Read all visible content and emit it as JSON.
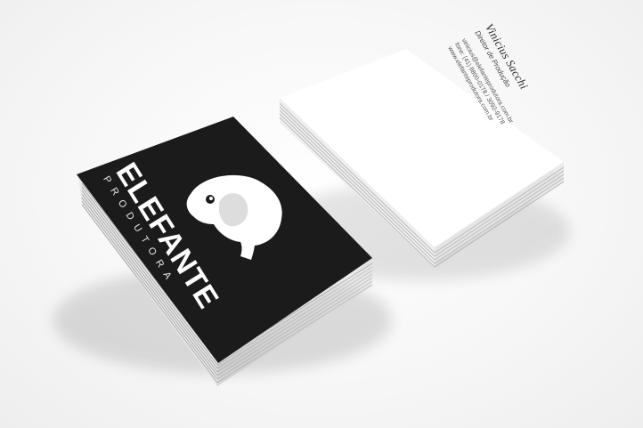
{
  "colors": {
    "background": "#f4f4f4",
    "dark_card": "#1b1b1b",
    "light_card": "#ffffff",
    "paper_edge": "#d9d9d9"
  },
  "logo_card": {
    "brand": "ELEFANTE",
    "sub": "PRODUTORA",
    "icon": "elephant-icon"
  },
  "info_card": {
    "name": "Vinicius Sacchi",
    "role": "Diretor de Produção",
    "email": "vinicius@elefanteprodutora.com.br",
    "phone": "fone: (41) 8800-0178 / 3092-9178",
    "web": "www.elefanteprodutora.com.br"
  }
}
